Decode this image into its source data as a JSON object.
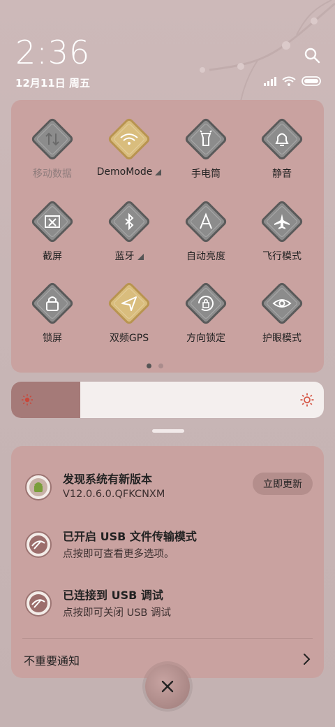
{
  "status": {
    "time": "2:36",
    "date": "12月11日 周五",
    "icons": [
      "signal-icon",
      "wifi-icon",
      "battery-icon"
    ]
  },
  "quick_settings": {
    "tiles": [
      {
        "label": "移动数据",
        "icon": "mobile-data-icon",
        "active": false,
        "disabled": true
      },
      {
        "label": "DemoMode",
        "icon": "wifi-icon",
        "active": true,
        "expand": true
      },
      {
        "label": "手电筒",
        "icon": "flashlight-icon",
        "active": false
      },
      {
        "label": "静音",
        "icon": "bell-icon",
        "active": false
      },
      {
        "label": "截屏",
        "icon": "screenshot-icon",
        "active": false
      },
      {
        "label": "蓝牙",
        "icon": "bluetooth-icon",
        "active": false,
        "expand": true
      },
      {
        "label": "自动亮度",
        "icon": "auto-brightness-icon",
        "active": false
      },
      {
        "label": "飞行模式",
        "icon": "airplane-icon",
        "active": false
      },
      {
        "label": "锁屏",
        "icon": "lock-icon",
        "active": false
      },
      {
        "label": "双频GPS",
        "icon": "gps-icon",
        "active": true
      },
      {
        "label": "方向锁定",
        "icon": "rotation-lock-icon",
        "active": false
      },
      {
        "label": "护眼模式",
        "icon": "eye-icon",
        "active": false
      }
    ],
    "page_indicator": {
      "pages": 2,
      "current": 1
    }
  },
  "brightness": {
    "level": 0.22
  },
  "notifications": [
    {
      "title": "发现系统有新版本",
      "subtitle": "V12.0.6.0.QFKCNXM",
      "action": "立即更新",
      "icon": "android-update-icon"
    },
    {
      "title": "已开启 USB 文件传输模式",
      "subtitle": "点按即可查看更多选项。",
      "icon": "usb-icon"
    },
    {
      "title": "已连接到 USB 调试",
      "subtitle": "点按即可关闭 USB 调试",
      "icon": "usb-icon"
    }
  ],
  "unimportant_label": "不重要通知",
  "colors": {
    "panel": "#c9a2a0",
    "tile_inactive": "#8c8c8c",
    "tile_active": "#d9bd7d",
    "brightness_fill": "#a57a78"
  }
}
